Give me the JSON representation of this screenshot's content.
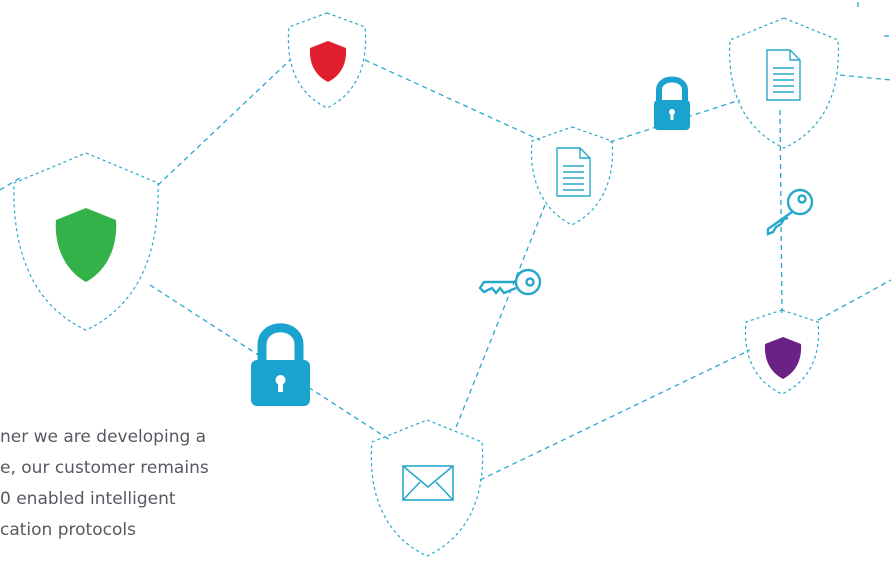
{
  "colors": {
    "line": "#28a9cc",
    "shield_outline": "#28a9cc",
    "red": "#e02031",
    "green": "#33b249",
    "purple": "#6b2285",
    "lock": "#1aa3cf",
    "text": "#555a60"
  },
  "icons": {
    "nodes": [
      "shield-red",
      "shield-green",
      "shield-document",
      "shield-document",
      "shield-purple",
      "shield-envelope"
    ],
    "connectors": [
      "lock-icon",
      "lock-icon",
      "key-icon",
      "key-icon"
    ]
  },
  "paragraph": {
    "line1": "ner we are developing a",
    "line2": "e, our customer remains",
    "line3": "0 enabled intelligent",
    "line4": "cation protocols"
  }
}
